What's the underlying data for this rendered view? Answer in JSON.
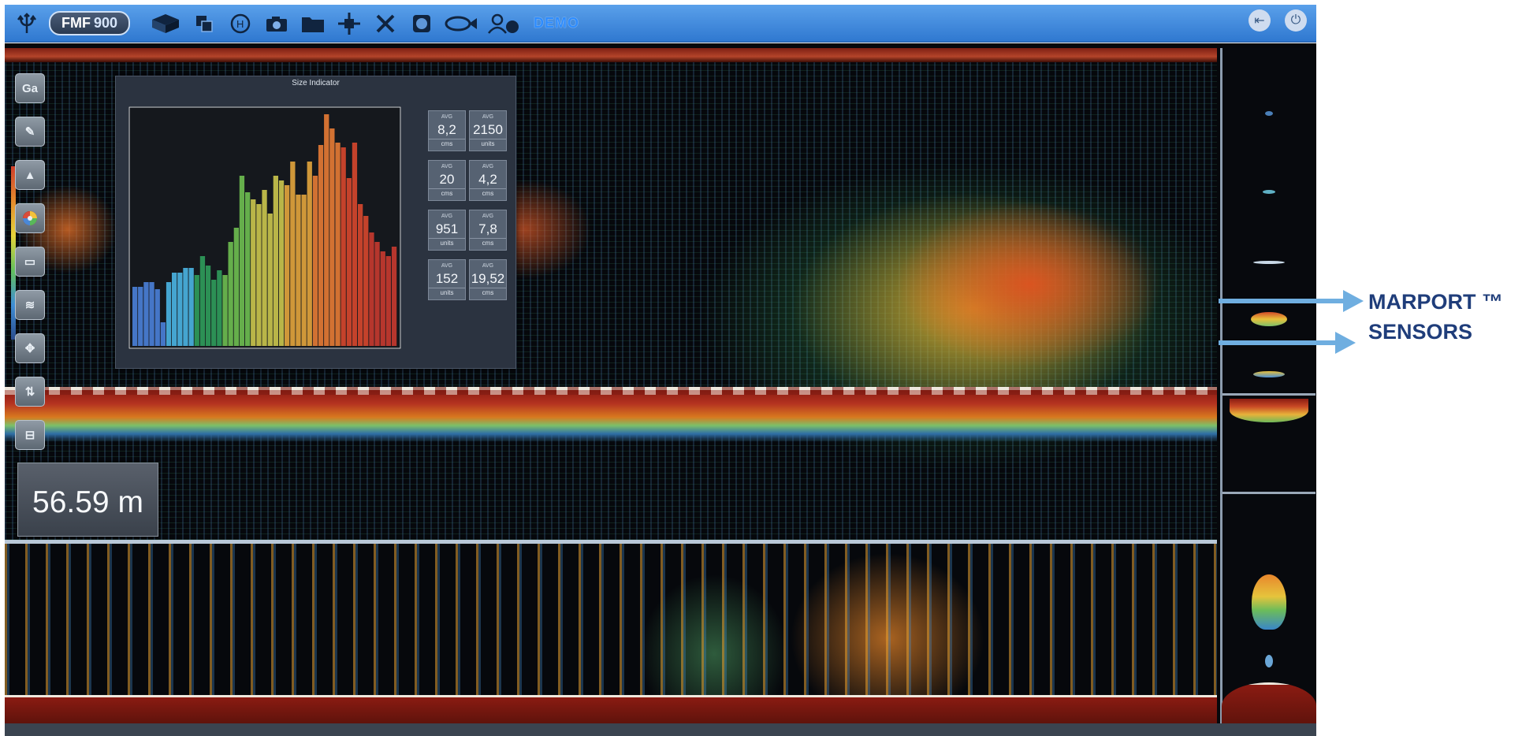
{
  "toolbar": {
    "product_badge": {
      "prefix": "FMF",
      "number": "900"
    },
    "demo_label": "DEMO",
    "icons": [
      "trident-logo-icon",
      "fmf-badge",
      "sonar-box-icon",
      "layers-icon",
      "history-icon",
      "camera-icon",
      "folder-icon",
      "move-crosshair-icon",
      "tools-icon",
      "target-icon",
      "fish-icon",
      "user-info-icon"
    ],
    "right_icons": [
      "exit-icon",
      "power-icon"
    ]
  },
  "size_indicator": {
    "title": "Size Indicator",
    "histogram_colors": [
      "#4a7fd6",
      "#4ab2e0",
      "#2f9b5a",
      "#6cbc4f",
      "#c8c34c",
      "#e0a33c",
      "#e37a34",
      "#d4472d",
      "#c43a2f"
    ],
    "stats": [
      [
        {
          "label": "AVG",
          "value": "8,2",
          "unit": "cms"
        },
        {
          "label": "AVG",
          "value": "2150",
          "unit": "units"
        }
      ],
      [
        {
          "label": "AVG",
          "value": "20",
          "unit": "cms"
        },
        {
          "label": "AVG",
          "value": "4,2",
          "unit": "cms"
        }
      ],
      [
        {
          "label": "AVG",
          "value": "951",
          "unit": "units"
        },
        {
          "label": "AVG",
          "value": "7,8",
          "unit": "cms"
        }
      ],
      [
        {
          "label": "AVG",
          "value": "152",
          "unit": "units"
        },
        {
          "label": "AVG",
          "value": "19,52",
          "unit": "cms"
        }
      ]
    ]
  },
  "depth_readout": {
    "value": "56.59 m"
  },
  "left_tools": [
    "Ga",
    "pencil-icon",
    "bottom-profile-icon",
    "palette-icon",
    "monitor-icon",
    "layers-stack-icon",
    "crosshair-icon",
    "level-icon",
    "ruler-icon"
  ],
  "annotation": {
    "line1": "MARPORT ™",
    "line2": "SENSORS"
  },
  "colors": {
    "toolbar": "#3a82d8",
    "annotation_arrow": "#6faee0",
    "annotation_text": "#1f3d7a"
  }
}
